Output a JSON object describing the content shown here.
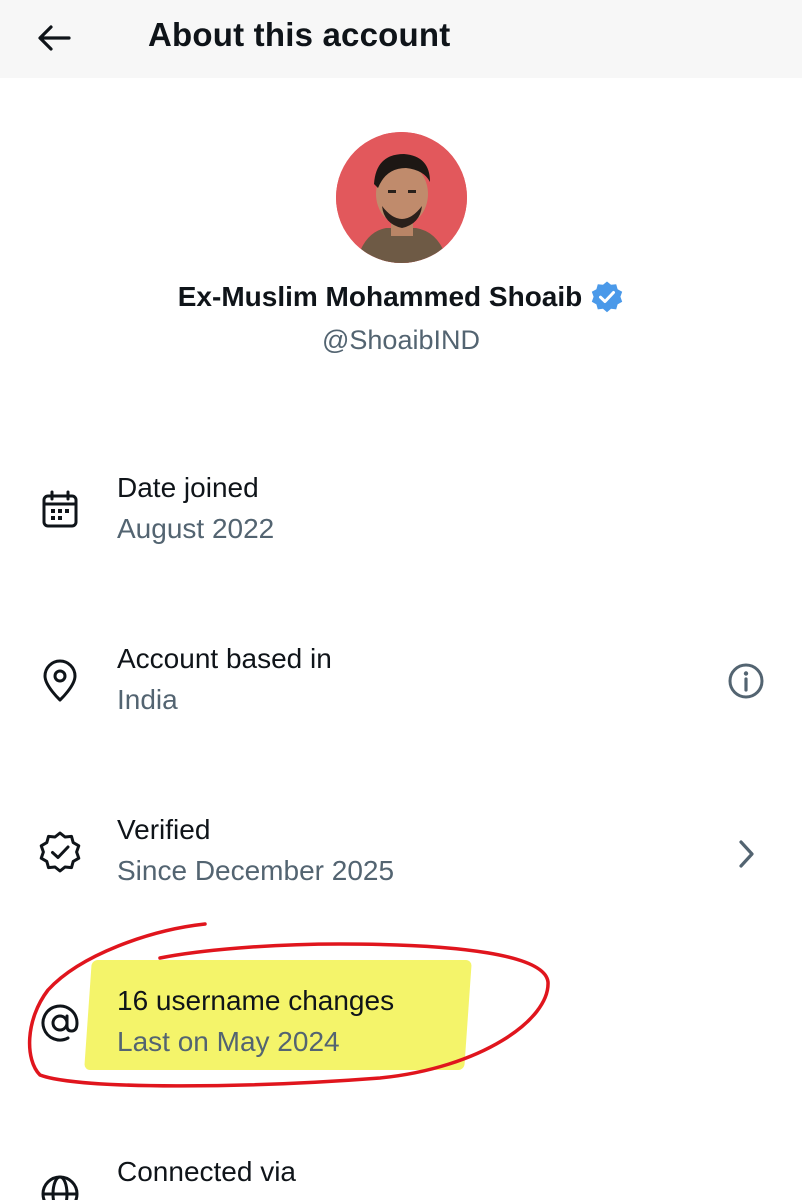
{
  "header": {
    "title": "About this account",
    "back_icon": "arrow-left-icon"
  },
  "profile": {
    "display_name": "Ex-Muslim Mohammed Shoaib",
    "handle": "@ShoaibIND",
    "verified_icon": "verified-badge-icon",
    "colors": {
      "verified": "#4a99e9",
      "avatar_bg": "#e2585c"
    }
  },
  "rows": [
    {
      "icon": "calendar-icon",
      "title": "Date joined",
      "subtitle": "August 2022"
    },
    {
      "icon": "location-pin-icon",
      "title": "Account based in",
      "subtitle": "India",
      "trailing_icon": "info-icon"
    },
    {
      "icon": "verified-check-icon",
      "title": "Verified",
      "subtitle": "Since December 2025",
      "trailing_icon": "chevron-right-icon"
    },
    {
      "icon": "at-sign-icon",
      "title": "16 username changes",
      "subtitle": "Last on May 2024"
    },
    {
      "icon": "globe-icon",
      "title": "Connected via",
      "subtitle": ""
    }
  ],
  "annotation": {
    "highlight_color": "#f3f35a",
    "circle_color": "#e0151d"
  }
}
